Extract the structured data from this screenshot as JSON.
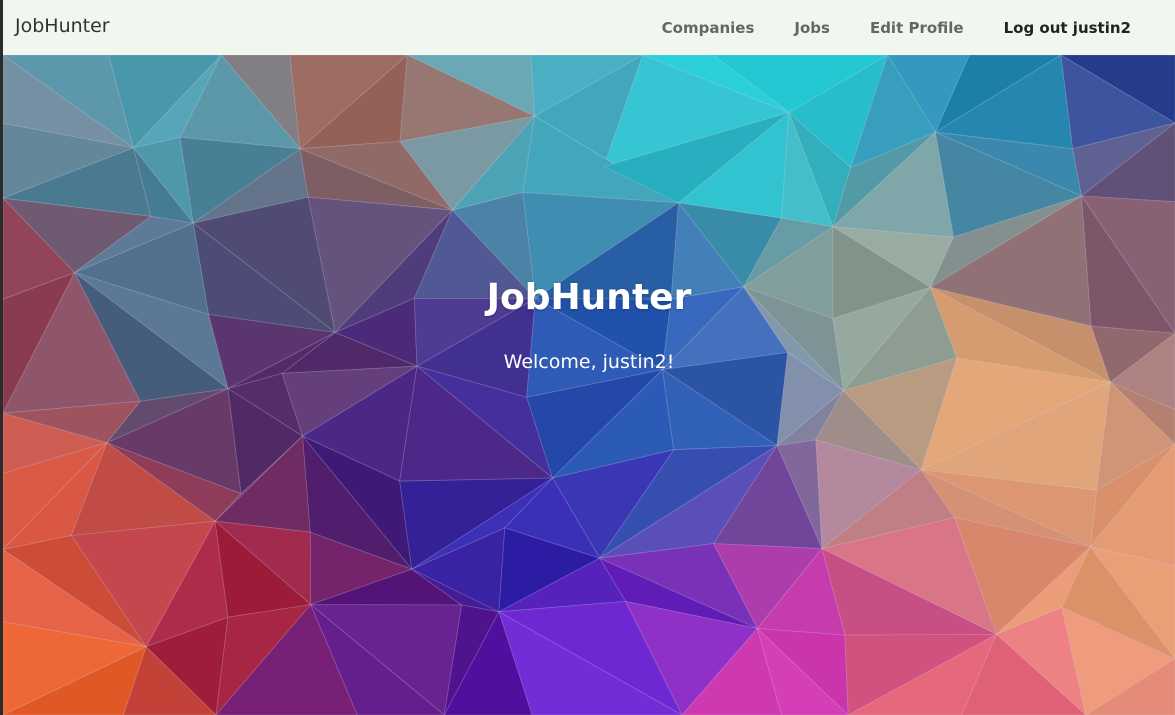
{
  "navbar": {
    "brand": "JobHunter",
    "links": {
      "companies": "Companies",
      "jobs": "Jobs",
      "edit_profile": "Edit Profile",
      "logout": "Log out justin2"
    }
  },
  "hero": {
    "title": "JobHunter",
    "subtitle": "Welcome, justin2!"
  },
  "colors": {
    "navbar_bg": "#f1f6ee",
    "hero_text": "#ffffff"
  }
}
